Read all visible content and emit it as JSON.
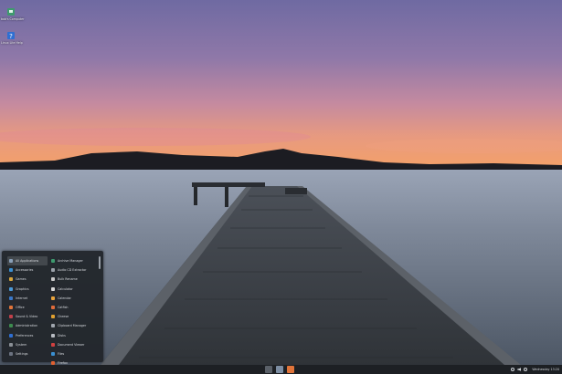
{
  "desktop": {
    "icons": [
      {
        "name": "home-folder-icon",
        "label": "bob's Computer",
        "color": "#3e9a6e"
      },
      {
        "name": "help-icon",
        "label": "Linux Lite Help",
        "color": "#2f6fd2"
      }
    ]
  },
  "app_menu": {
    "categories": [
      {
        "label": "All Applications",
        "icon": "all-apps-icon",
        "color": "#8aa0b8",
        "active": true
      },
      {
        "label": "Accessories",
        "icon": "accessories-icon",
        "color": "#3a8fd1"
      },
      {
        "label": "Games",
        "icon": "games-icon",
        "color": "#d9a63b"
      },
      {
        "label": "Graphics",
        "icon": "graphics-icon",
        "color": "#4b9ad8"
      },
      {
        "label": "Internet",
        "icon": "internet-icon",
        "color": "#3a78c9"
      },
      {
        "label": "Office",
        "icon": "office-icon",
        "color": "#e0743a"
      },
      {
        "label": "Sound & Video",
        "icon": "multimedia-icon",
        "color": "#c0404a"
      },
      {
        "label": "Administration",
        "icon": "administration-icon",
        "color": "#3d8b4f"
      },
      {
        "label": "Preferences",
        "icon": "preferences-icon",
        "color": "#2f6fd2"
      },
      {
        "label": "System",
        "icon": "system-icon",
        "color": "#8a8f96"
      },
      {
        "label": "Settings",
        "icon": "settings-icon",
        "color": "#6b7280"
      }
    ],
    "apps": [
      {
        "label": "Archive Manager",
        "icon": "archive-icon",
        "color": "#3e9a6e"
      },
      {
        "label": "Audio CD Extractor",
        "icon": "cd-icon",
        "color": "#9aa0a8"
      },
      {
        "label": "Bulk Rename",
        "icon": "rename-icon",
        "color": "#c8c8c8"
      },
      {
        "label": "Calculator",
        "icon": "calculator-icon",
        "color": "#d8d8d8"
      },
      {
        "label": "Calendar",
        "icon": "calendar-icon",
        "color": "#e8a33c"
      },
      {
        "label": "Catfish",
        "icon": "search-icon",
        "color": "#e06b3a"
      },
      {
        "label": "Cheese",
        "icon": "camera-icon",
        "color": "#e0a030"
      },
      {
        "label": "Clipboard Manager",
        "icon": "clipboard-icon",
        "color": "#a0a6ae"
      },
      {
        "label": "Disks",
        "icon": "disks-icon",
        "color": "#b8bcc2"
      },
      {
        "label": "Document Viewer",
        "icon": "document-icon",
        "color": "#d04040"
      },
      {
        "label": "Files",
        "icon": "files-icon",
        "color": "#3a8fd1"
      },
      {
        "label": "Firefox",
        "icon": "firefox-icon",
        "color": "#e06030"
      }
    ]
  },
  "taskbar": {
    "launchers": [
      {
        "name": "terminal-launcher-icon",
        "color": "#5a6068"
      },
      {
        "name": "files-launcher-icon",
        "color": "#7d8ea3"
      },
      {
        "name": "browser-launcher-icon",
        "color": "#e0743a"
      }
    ],
    "clock": "Wednesday 13:20"
  }
}
